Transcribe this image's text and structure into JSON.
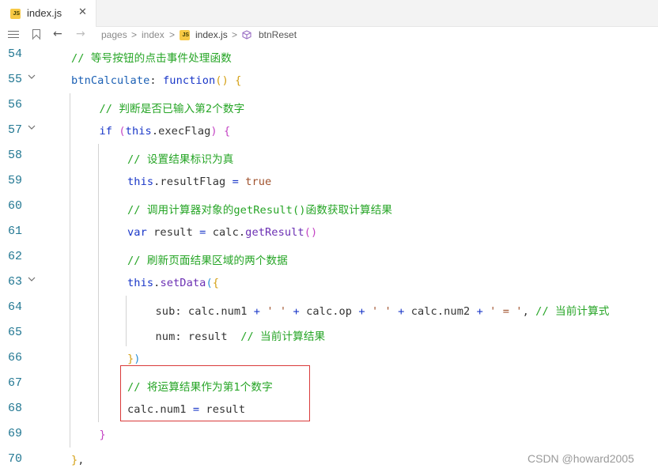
{
  "tab": {
    "badge": "JS",
    "label": "index.js",
    "close": "✕"
  },
  "breadcrumb": {
    "pages": "pages",
    "index": "index",
    "separator": ">",
    "file": "index.js",
    "method": "btnReset",
    "back": "←",
    "forward": "→"
  },
  "colors": {
    "comment": "#26a526",
    "keyword": "#1a37c8",
    "string": "#a0522d",
    "function": "#6b2fb3",
    "lineNumber": "#237893",
    "highlight": "#d93a3a"
  },
  "lines": [
    {
      "n": "54",
      "tokens": [
        [
          "c-cmt",
          "// 等号按钮的点击事件处理函数"
        ]
      ]
    },
    {
      "n": "55",
      "tokens": [
        [
          "c-prop",
          "btnCalculate"
        ],
        [
          "c-plain",
          ": "
        ],
        [
          "c-kw",
          "function"
        ],
        [
          "c-b1",
          "()"
        ],
        [
          "c-plain",
          " "
        ],
        [
          "c-b1",
          "{"
        ]
      ]
    },
    {
      "n": "56",
      "tokens": [
        [
          "c-cmt",
          "// 判断是否已输入第2个数字"
        ]
      ]
    },
    {
      "n": "57",
      "tokens": [
        [
          "c-kw",
          "if"
        ],
        [
          "c-plain",
          " "
        ],
        [
          "c-b2",
          "("
        ],
        [
          "c-kw",
          "this"
        ],
        [
          "c-plain",
          "."
        ],
        [
          "c-plain",
          "execFlag"
        ],
        [
          "c-b2",
          ")"
        ],
        [
          "c-plain",
          " "
        ],
        [
          "c-b2",
          "{"
        ]
      ]
    },
    {
      "n": "58",
      "tokens": [
        [
          "c-cmt",
          "// 设置结果标识为真"
        ]
      ]
    },
    {
      "n": "59",
      "tokens": [
        [
          "c-kw",
          "this"
        ],
        [
          "c-plain",
          ".resultFlag "
        ],
        [
          "c-op",
          "="
        ],
        [
          "c-plain",
          " "
        ],
        [
          "c-str",
          "true"
        ]
      ]
    },
    {
      "n": "60",
      "tokens": [
        [
          "c-cmt",
          "// 调用计算器对象的getResult()函数获取计算结果"
        ]
      ]
    },
    {
      "n": "61",
      "tokens": [
        [
          "c-kw",
          "var"
        ],
        [
          "c-plain",
          " result "
        ],
        [
          "c-op",
          "="
        ],
        [
          "c-plain",
          " calc."
        ],
        [
          "c-fn",
          "getResult"
        ],
        [
          "c-b2",
          "()"
        ]
      ]
    },
    {
      "n": "62",
      "tokens": [
        [
          "c-cmt",
          "// 刷新页面结果区域的两个数据"
        ]
      ]
    },
    {
      "n": "63",
      "tokens": [
        [
          "c-kw",
          "this"
        ],
        [
          "c-plain",
          "."
        ],
        [
          "c-fn",
          "setData"
        ],
        [
          "c-b3",
          "("
        ],
        [
          "c-b1",
          "{"
        ]
      ]
    },
    {
      "n": "64",
      "tokens": [
        [
          "c-plain",
          "sub: calc.num1 "
        ],
        [
          "c-op",
          "+"
        ],
        [
          "c-plain",
          " "
        ],
        [
          "c-str",
          "' '"
        ],
        [
          "c-plain",
          " "
        ],
        [
          "c-op",
          "+"
        ],
        [
          "c-plain",
          " calc.op "
        ],
        [
          "c-op",
          "+"
        ],
        [
          "c-plain",
          " "
        ],
        [
          "c-str",
          "' '"
        ],
        [
          "c-plain",
          " "
        ],
        [
          "c-op",
          "+"
        ],
        [
          "c-plain",
          " calc.num2 "
        ],
        [
          "c-op",
          "+"
        ],
        [
          "c-plain",
          " "
        ],
        [
          "c-str",
          "' = '"
        ],
        [
          "c-plain",
          ", "
        ],
        [
          "c-cmt",
          "// 当前计算式"
        ]
      ]
    },
    {
      "n": "65",
      "tokens": [
        [
          "c-plain",
          "num: result  "
        ],
        [
          "c-cmt",
          "// 当前计算结果"
        ]
      ]
    },
    {
      "n": "66",
      "tokens": [
        [
          "c-b1",
          "}"
        ],
        [
          "c-b3",
          ")"
        ]
      ]
    },
    {
      "n": "67",
      "tokens": [
        [
          "c-cmt",
          "// 将运算结果作为第1个数字"
        ]
      ]
    },
    {
      "n": "68",
      "tokens": [
        [
          "c-plain",
          "calc.num1 "
        ],
        [
          "c-op",
          "="
        ],
        [
          "c-plain",
          " result"
        ]
      ]
    },
    {
      "n": "69",
      "tokens": [
        [
          "c-b2",
          "}"
        ]
      ]
    },
    {
      "n": "70",
      "tokens": [
        [
          "c-b1",
          "}"
        ],
        [
          "c-plain",
          ","
        ]
      ]
    }
  ],
  "watermark": "CSDN @howard2005"
}
